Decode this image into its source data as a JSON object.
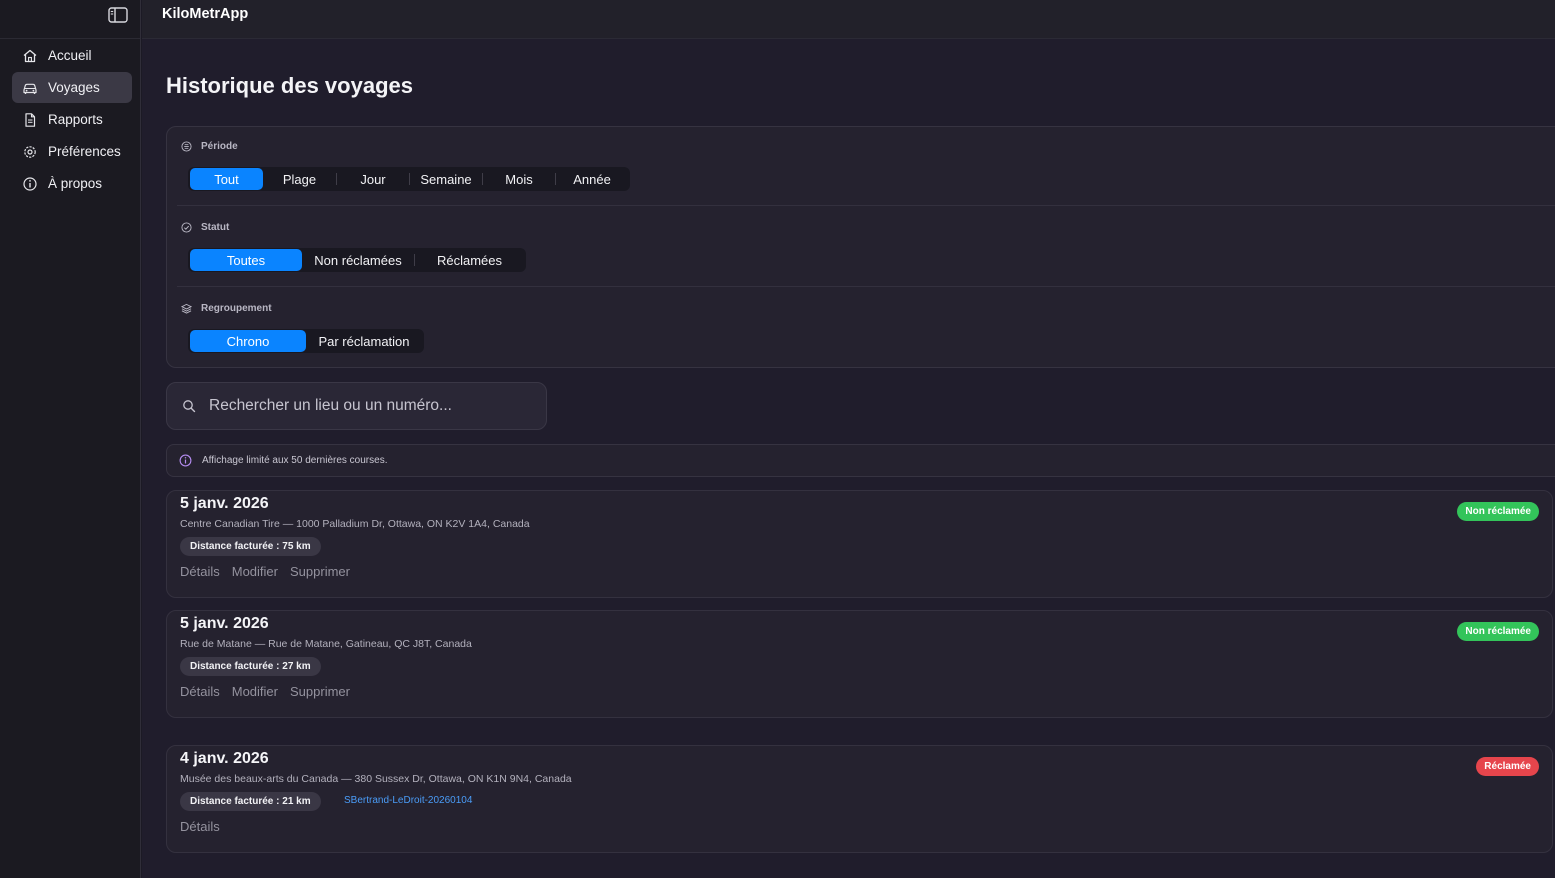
{
  "app": {
    "title": "KiloMetrApp"
  },
  "sidebar": {
    "items": [
      {
        "label": "Accueil",
        "icon": "house-icon"
      },
      {
        "label": "Voyages",
        "icon": "car-icon",
        "active": true
      },
      {
        "label": "Rapports",
        "icon": "document-icon"
      },
      {
        "label": "Préférences",
        "icon": "gear-icon"
      },
      {
        "label": "À propos",
        "icon": "info-icon"
      }
    ]
  },
  "page": {
    "title": "Historique des voyages"
  },
  "filters": {
    "period": {
      "label": "Période",
      "options": [
        "Tout",
        "Plage",
        "Jour",
        "Semaine",
        "Mois",
        "Année"
      ],
      "selected": "Tout"
    },
    "status": {
      "label": "Statut",
      "options": [
        "Toutes",
        "Non réclamées",
        "Réclamées"
      ],
      "selected": "Toutes"
    },
    "grouping": {
      "label": "Regroupement",
      "options": [
        "Chrono",
        "Par réclamation"
      ],
      "selected": "Chrono"
    }
  },
  "search": {
    "placeholder": "Rechercher un lieu ou un numéro..."
  },
  "notice": {
    "text": "Affichage limité aux 50 dernières courses."
  },
  "trips": [
    {
      "date": "5 janv. 2026",
      "address": "Centre Canadian Tire — 1000 Palladium Dr, Ottawa, ON K2V 1A4, Canada",
      "distance": "Distance facturée : 75 km",
      "status": "Non réclamée",
      "status_color": "#33c45a",
      "claim_id": "",
      "actions": [
        "Détails",
        "Modifier",
        "Supprimer"
      ]
    },
    {
      "date": "5 janv. 2026",
      "address": "Rue de Matane — Rue de Matane, Gatineau, QC J8T, Canada",
      "distance": "Distance facturée : 27 km",
      "status": "Non réclamée",
      "status_color": "#33c45a",
      "claim_id": "",
      "actions": [
        "Détails",
        "Modifier",
        "Supprimer"
      ]
    },
    {
      "date": "4 janv. 2026",
      "address": "Musée des beaux-arts du Canada — 380 Sussex Dr, Ottawa, ON K1N 9N4, Canada",
      "distance": "Distance facturée : 21 km",
      "status": "Réclamée",
      "status_color": "#e6454c",
      "claim_id": "SBertrand-LeDroit-20260104",
      "actions": [
        "Détails"
      ]
    }
  ],
  "colors": {
    "accent": "#0a84ff",
    "unclaimed": "#33c45a",
    "claimed": "#e6454c",
    "link": "#4a9cf7"
  }
}
